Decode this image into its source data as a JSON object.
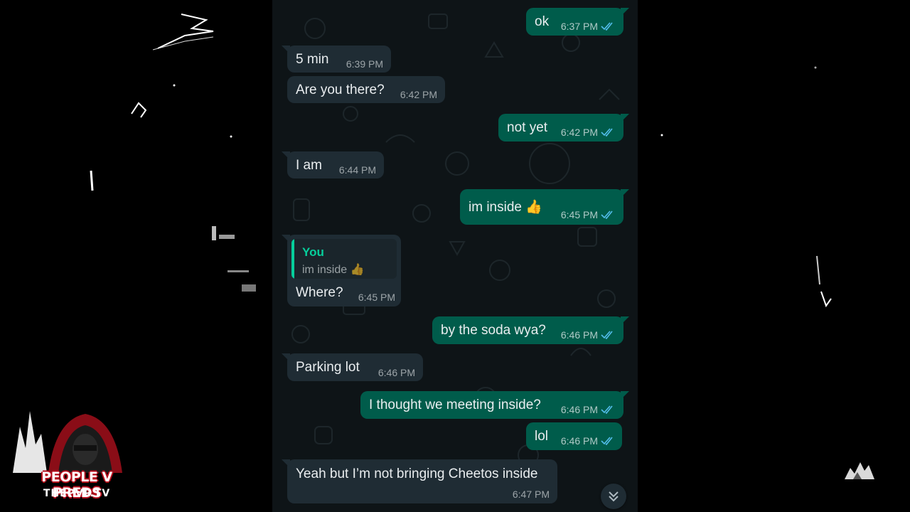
{
  "chat": {
    "messages": [
      {
        "dir": "out",
        "text": "ok",
        "time": "6:37 PM"
      },
      {
        "dir": "in",
        "text": "5 min",
        "time": "6:39 PM"
      },
      {
        "dir": "in",
        "text": "Are you there?",
        "time": "6:42 PM"
      },
      {
        "dir": "out",
        "text": "not yet",
        "time": "6:42 PM"
      },
      {
        "dir": "in",
        "text": "I am",
        "time": "6:44 PM"
      },
      {
        "dir": "out",
        "text": "im inside 👍",
        "time": "6:45 PM"
      },
      {
        "dir": "in",
        "text": "Where?",
        "time": "6:45 PM",
        "quote_author": "You",
        "quote_text": "im inside 👍"
      },
      {
        "dir": "out",
        "text": "by the soda wya?",
        "time": "6:46 PM"
      },
      {
        "dir": "in",
        "text": "Parking lot",
        "time": "6:46 PM"
      },
      {
        "dir": "out",
        "text": "I thought we meeting inside?",
        "time": "6:46 PM"
      },
      {
        "dir": "out",
        "text": "lol",
        "time": "6:46 PM"
      },
      {
        "dir": "in",
        "text": "Yeah but I’m not bringing Cheetos inside",
        "time": "6:47 PM"
      }
    ],
    "scroll_down_icon": "double-chevron-down-icon",
    "read_receipt_icon": "double-check-icon"
  },
  "watermark": {
    "brand": "PEOPLE V PREDS",
    "site": "THEPVP.TV",
    "logo_icon": "hooded-figure-logo-icon"
  },
  "colors": {
    "outgoing_bubble": "#005c4b",
    "incoming_bubble": "#1f2c34",
    "chat_background": "#0e1417",
    "read_ticks": "#53bdeb",
    "quote_accent": "#06cf9c",
    "logo_red": "#b50d1c"
  }
}
